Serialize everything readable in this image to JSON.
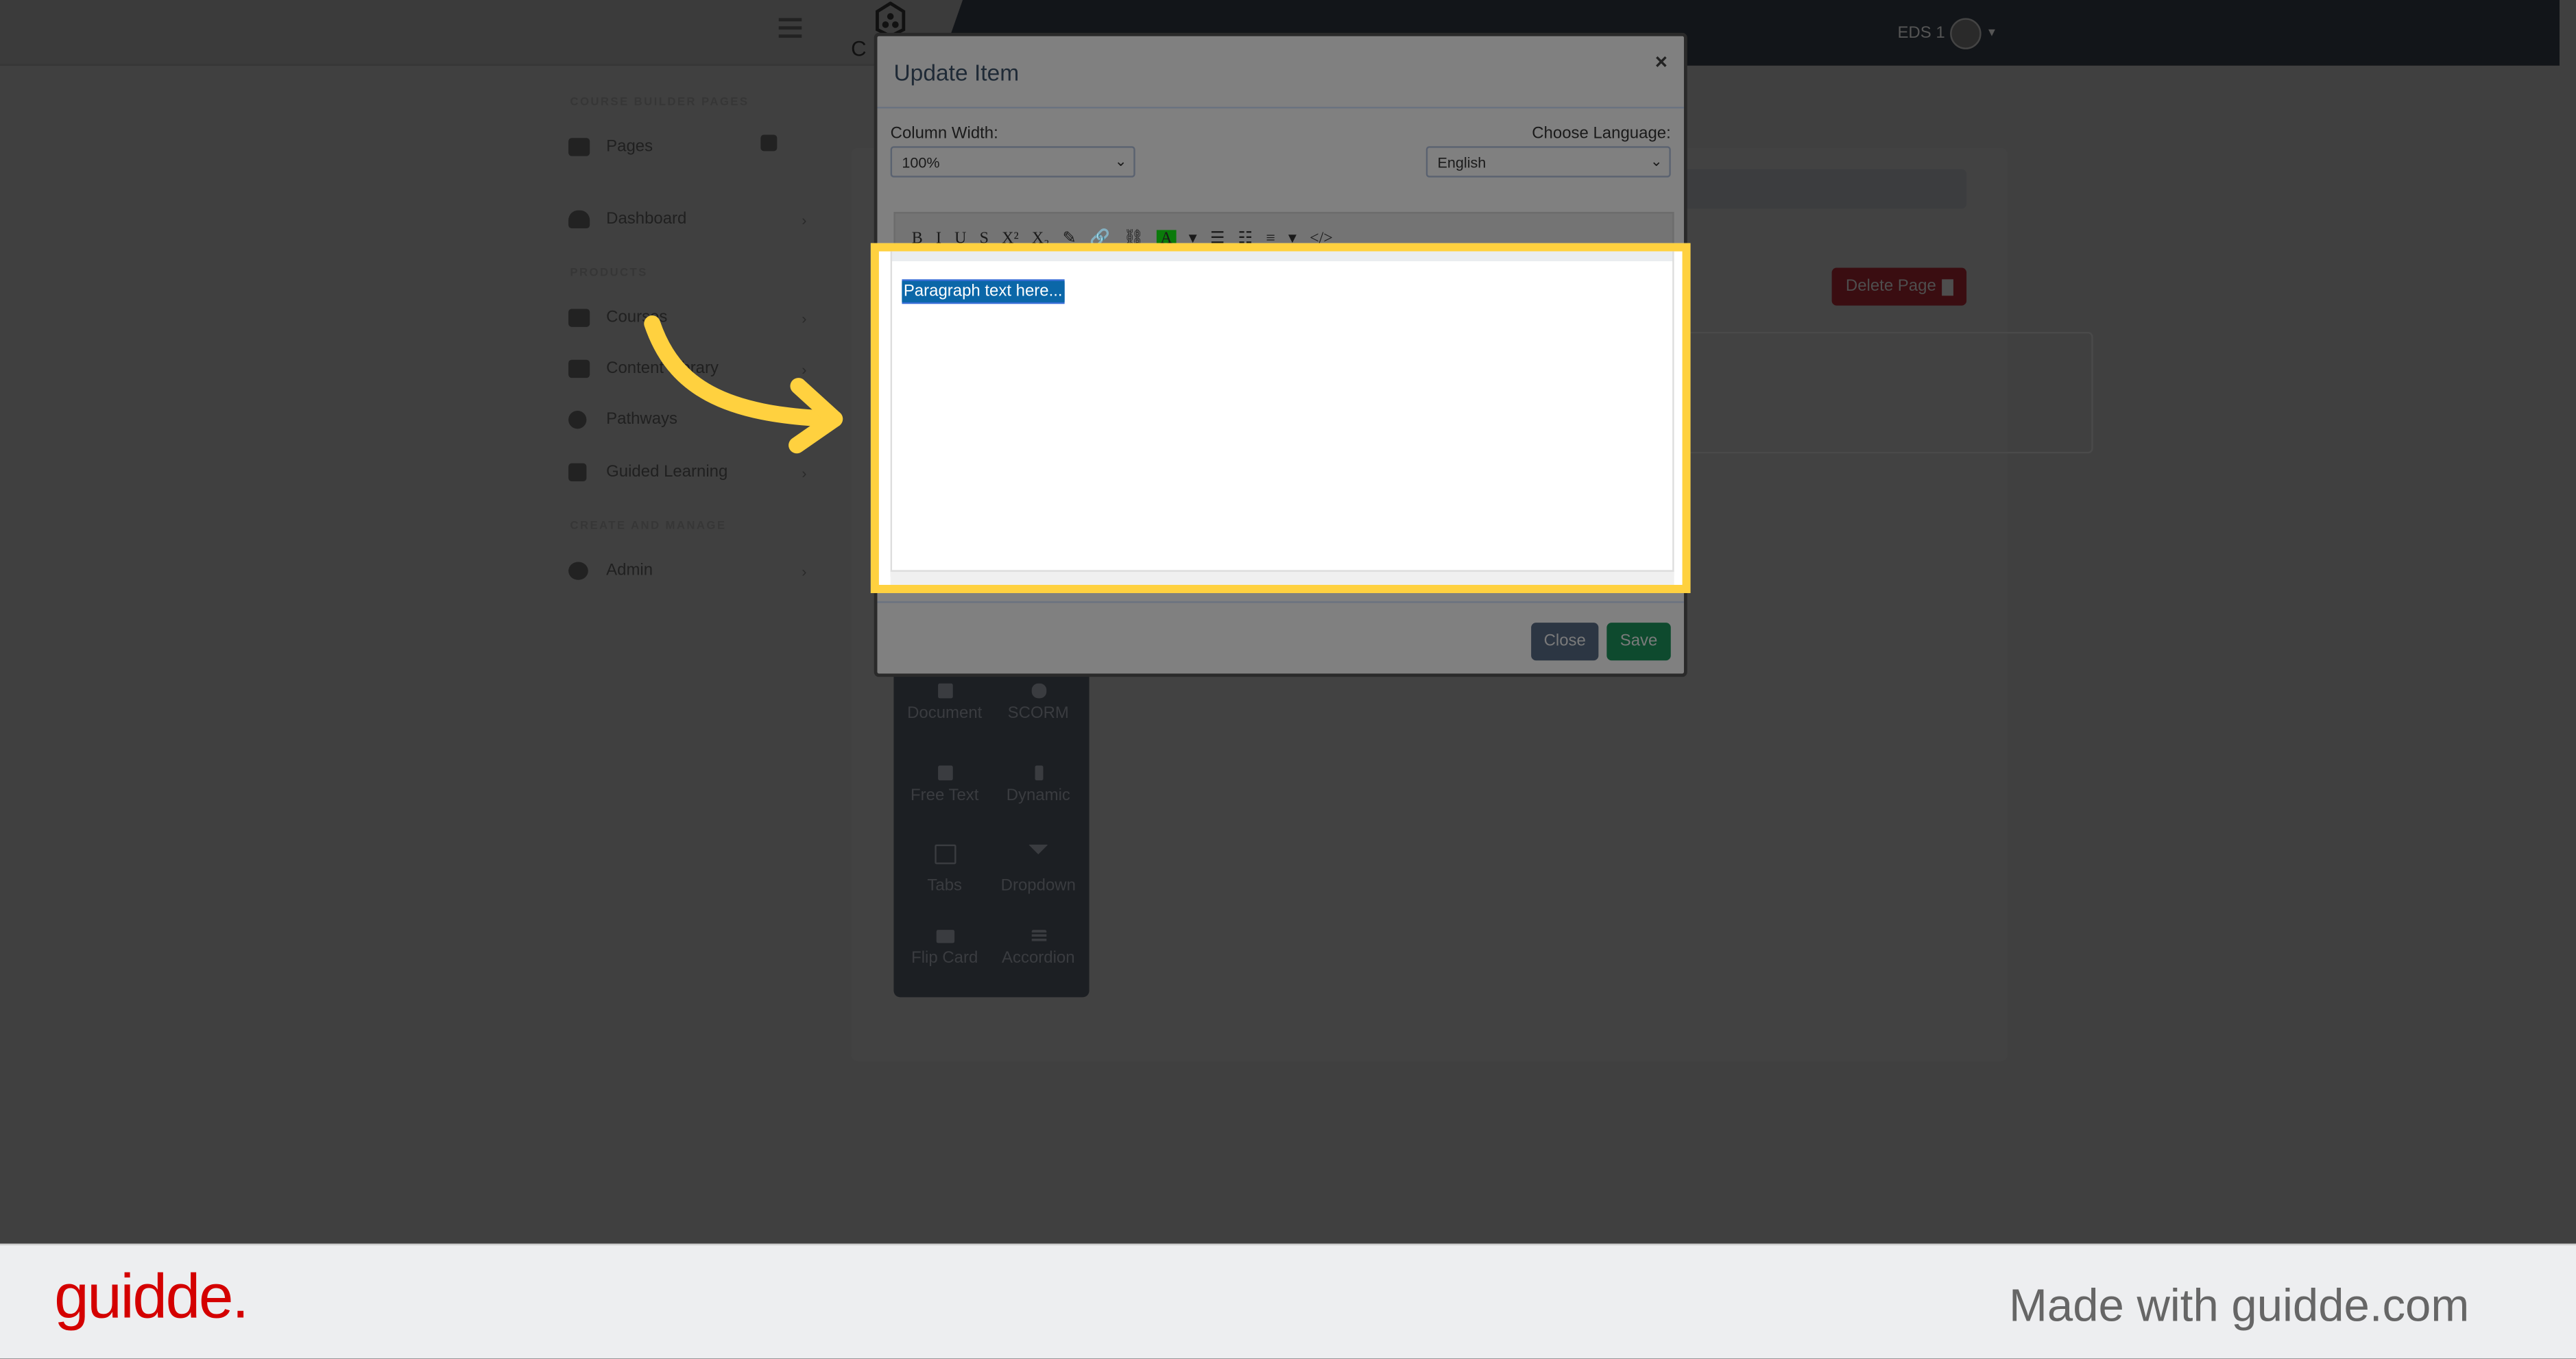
{
  "header": {
    "user_label": "EDS 1",
    "brand_initial": "C"
  },
  "sidebar": {
    "sections": [
      {
        "title": "COURSE BUILDER PAGES",
        "items": [
          {
            "label": "Pages",
            "icon": "bank-icon",
            "action": "plus-square-icon"
          },
          {
            "label": "Dashboard",
            "icon": "tachometer-icon"
          }
        ]
      },
      {
        "title": "PRODUCTS",
        "items": [
          {
            "label": "Courses",
            "icon": "chalkboard-teacher-icon"
          },
          {
            "label": "Content Library",
            "icon": "book-icon"
          },
          {
            "label": "Pathways",
            "icon": "award-icon"
          },
          {
            "label": "Guided Learning",
            "icon": "clipboard-list-icon"
          }
        ]
      },
      {
        "title": "CREATE AND MANAGE",
        "items": [
          {
            "label": "Admin",
            "icon": "gear-icon"
          }
        ]
      }
    ]
  },
  "main": {
    "delete_page_label": "Delete Page",
    "palette": [
      "Document",
      "SCORM",
      "Free Text",
      "Dynamic",
      "Tabs",
      "Dropdown",
      "Flip Card",
      "Accordion"
    ]
  },
  "modal": {
    "title": "Update Item",
    "close_symbol": "×",
    "column_width_label": "Column Width:",
    "column_width_value": "100%",
    "language_label": "Choose Language:",
    "language_value": "English",
    "toolbar": [
      "B",
      "I",
      "U",
      "S",
      "X²",
      "X₂",
      "✎",
      "🔗",
      "⛓",
      "A",
      "▾",
      "☰",
      "☷",
      "≡",
      "▾",
      "</>"
    ],
    "editor_text": "Paragraph text here...",
    "close_label": "Close",
    "save_label": "Save"
  },
  "colors": {
    "highlight": "#ffd13f",
    "save": "#0e4a2e",
    "close": "#2c3643",
    "delete": "#3a0d11",
    "brand": "#d40000"
  },
  "footer": {
    "logo": "guidde.",
    "made_with": "Made with guidde.com"
  }
}
